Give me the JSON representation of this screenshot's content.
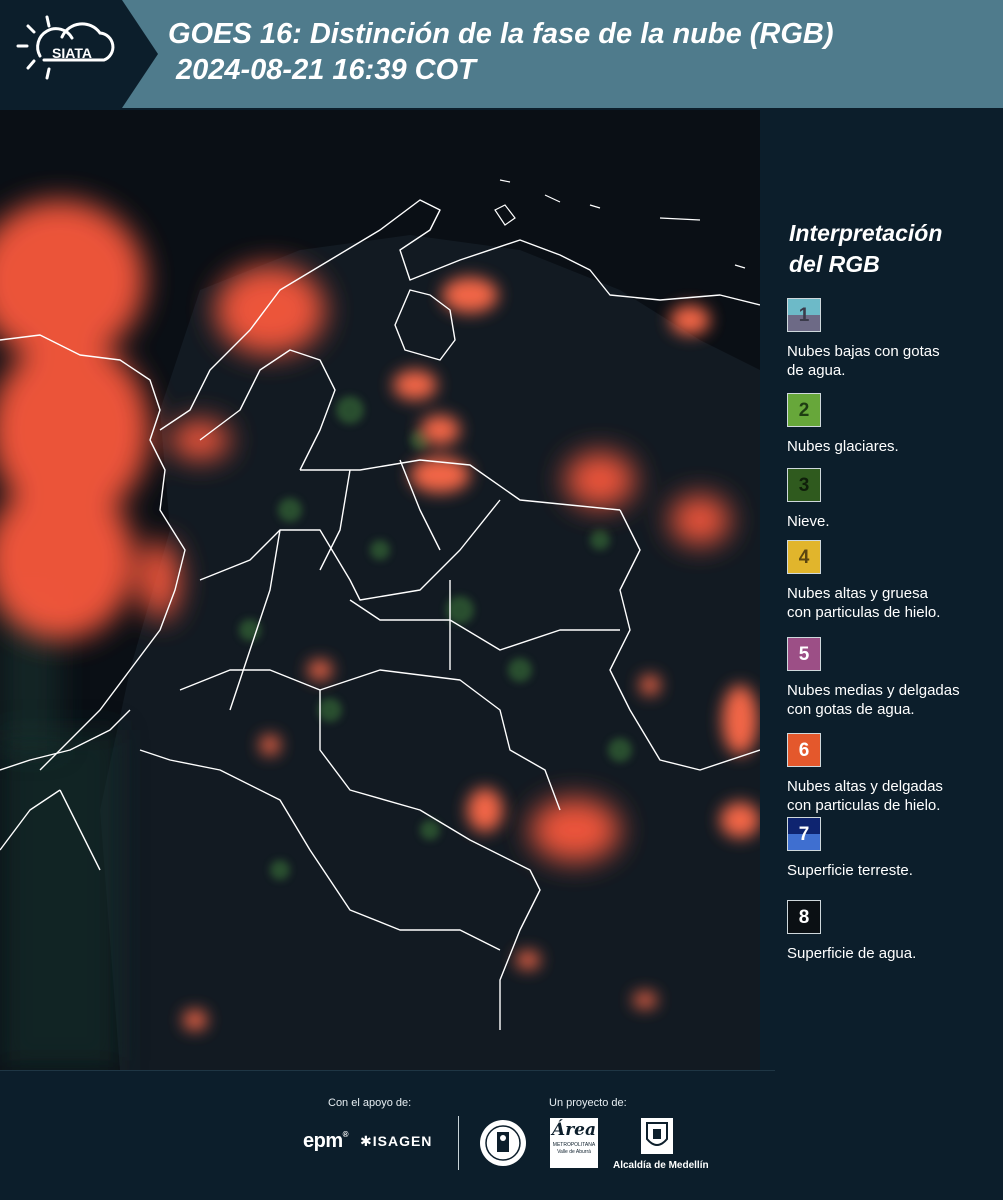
{
  "header": {
    "logo_text": "SIATA",
    "title_line1": "GOES 16: Distinción de la fase de la nube (RGB)",
    "title_line2": "2024-08-21 16:39 COT"
  },
  "legend": {
    "title_line1": "Interpretación",
    "title_line2": "del RGB",
    "items": [
      {
        "number": "1",
        "desc_line1": "Nubes bajas con gotas",
        "desc_line2": "de agua.",
        "color_top": "#6dbac8",
        "color_bottom": "#6d6a86",
        "text_color": "#3a3a4a"
      },
      {
        "number": "2",
        "desc_line1": "Nubes glaciares.",
        "desc_line2": "",
        "color_top": "#67a73a",
        "color_bottom": "#67a73a",
        "text_color": "#1e3d12"
      },
      {
        "number": "3",
        "desc_line1": "Nieve.",
        "desc_line2": "",
        "color_top": "#2f5a1e",
        "color_bottom": "#2f5a1e",
        "text_color": "#0f1f0a"
      },
      {
        "number": "4",
        "desc_line1": "Nubes altas y gruesa",
        "desc_line2": "con particulas de hielo.",
        "color_top": "#e1b52c",
        "color_bottom": "#e1b52c",
        "text_color": "#5a4510"
      },
      {
        "number": "5",
        "desc_line1": "Nubes medias y delgadas",
        "desc_line2": "con gotas de agua.",
        "color_top": "#9c4f86",
        "color_bottom": "#9c4f86",
        "text_color": "#ffffff"
      },
      {
        "number": "6",
        "desc_line1": "Nubes altas y delgadas",
        "desc_line2": "con particulas de hielo.",
        "color_top": "#e4582c",
        "color_bottom": "#e4582c",
        "text_color": "#ffffff"
      },
      {
        "number": "7",
        "desc_line1": "Superficie terreste.",
        "desc_line2": "",
        "color_top": "#0e2470",
        "color_bottom": "#3f6fd0",
        "text_color": "#ffffff"
      },
      {
        "number": "8",
        "desc_line1": "Superficie de agua.",
        "desc_line2": "",
        "color_top": "#0b1014",
        "color_bottom": "#0b1014",
        "text_color": "#ffffff"
      }
    ]
  },
  "footer": {
    "support_label": "Con el apoyo de:",
    "project_label": "Un proyecto de:",
    "sponsor1": "epm",
    "sponsor2": "ISAGEN",
    "partner_area": "Área",
    "partner_area_sub1": "METROPOLITANA",
    "partner_area_sub2": "Valle de Aburrá",
    "partner_alcaldia": "Alcaldía de Medellín"
  },
  "colors": {
    "header_bg": "#4f7b8c",
    "page_bg": "#0c1e2b",
    "cloud_ice": "#ff5a3c",
    "map_bg": "#0a0f15"
  }
}
